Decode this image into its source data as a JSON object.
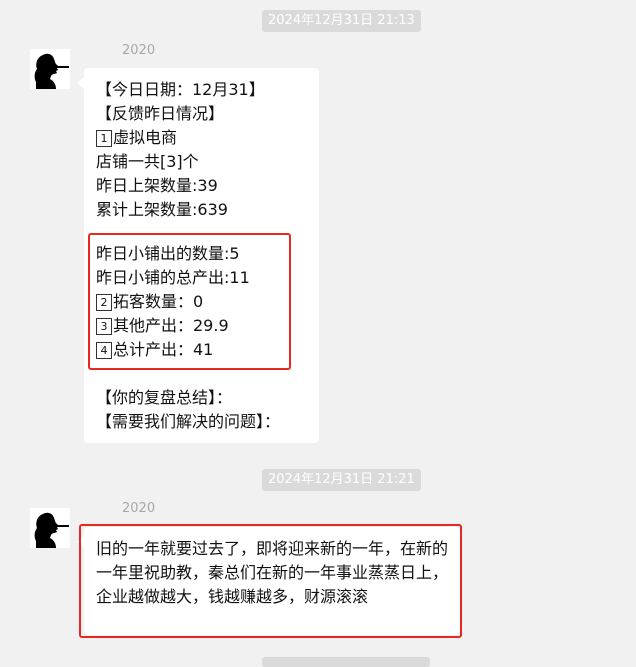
{
  "messages": [
    {
      "timestamp": "2024年12月31日 21:13",
      "sender": "2020",
      "lines": {
        "l1": "【今日日期：12月31】",
        "l2": "【反馈昨日情况】",
        "l3_num": "1",
        "l3": "虚拟电商",
        "l4": "店铺一共[3]个",
        "l5": "昨日上架数量:39",
        "l6": "累计上架数量:639",
        "l7": "昨日小铺出的数量:5",
        "l8": "昨日小铺的总产出:11",
        "l9_num": "2",
        "l9": "拓客数量：0",
        "l10_num": "3",
        "l10": "其他产出：29.9",
        "l11_num": "4",
        "l11": "总计产出：41",
        "l12": "【你的复盘总结】：",
        "l13": "【需要我们解决的问题】："
      }
    },
    {
      "timestamp": "2024年12月31日 21:21",
      "sender": "2020",
      "text": "旧的一年就要过去了，即将迎来新的一年，在新的一年里祝助教，秦总们在新的一年事业蒸蒸日上，企业越做越大，钱越赚越多，财源滚滚"
    }
  ],
  "colors": {
    "background": "#f1f1f1",
    "bubble": "#ffffff",
    "highlight_border": "#e8281e",
    "timestamp_pill": "#dadada"
  },
  "icons": {
    "avatar": "silhouette-profile-avatar-icon"
  }
}
